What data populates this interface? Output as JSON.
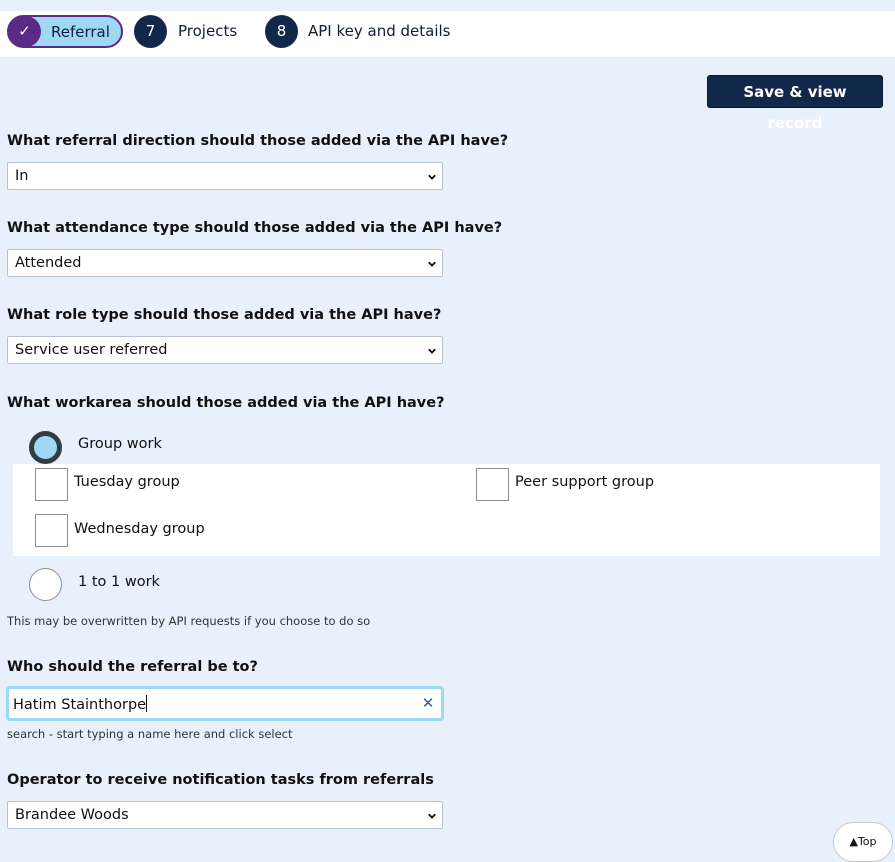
{
  "stepper": {
    "current": {
      "icon": "check-icon",
      "glyph": "✓",
      "label": "Referral"
    },
    "steps": [
      {
        "number": "7",
        "label": "Projects"
      },
      {
        "number": "8",
        "label": "API key and details"
      }
    ]
  },
  "toolbar": {
    "save_label": "Save & view record"
  },
  "referral_direction": {
    "question": "What referral direction should those added via the API have?",
    "value": "In"
  },
  "attendance_type": {
    "question": "What attendance type should those added via the API have?",
    "value": "Attended"
  },
  "role_type": {
    "question": "What role type should those added via the API have?",
    "value": "Service user referred"
  },
  "workarea": {
    "question": "What workarea should those added via the API have?",
    "options": [
      {
        "label": "Group work",
        "selected": true,
        "groups": [
          {
            "label": "Tuesday group",
            "checked": false
          },
          {
            "label": "Peer support group",
            "checked": false
          },
          {
            "label": "Wednesday group",
            "checked": false
          }
        ]
      },
      {
        "label": "1 to 1 work",
        "selected": false
      }
    ],
    "hint": "This may be overwritten by API requests if you choose to do so"
  },
  "referral_to": {
    "question": "Who should the referral be to?",
    "value": "Hatim Stainthorpe",
    "clear_icon": "close-icon",
    "clear_glyph": "✕",
    "hint": "search - start typing a name here and click select"
  },
  "operator": {
    "question": "Operator to receive notification tasks from referrals",
    "value": "Brandee Woods"
  },
  "scroll_top": {
    "label": "▲Top"
  },
  "colors": {
    "page_bg": "#e8f0fc",
    "brand_navy": "#12284a",
    "brand_purple": "#5b2a86",
    "accent_cyan": "#9fd8f4"
  }
}
